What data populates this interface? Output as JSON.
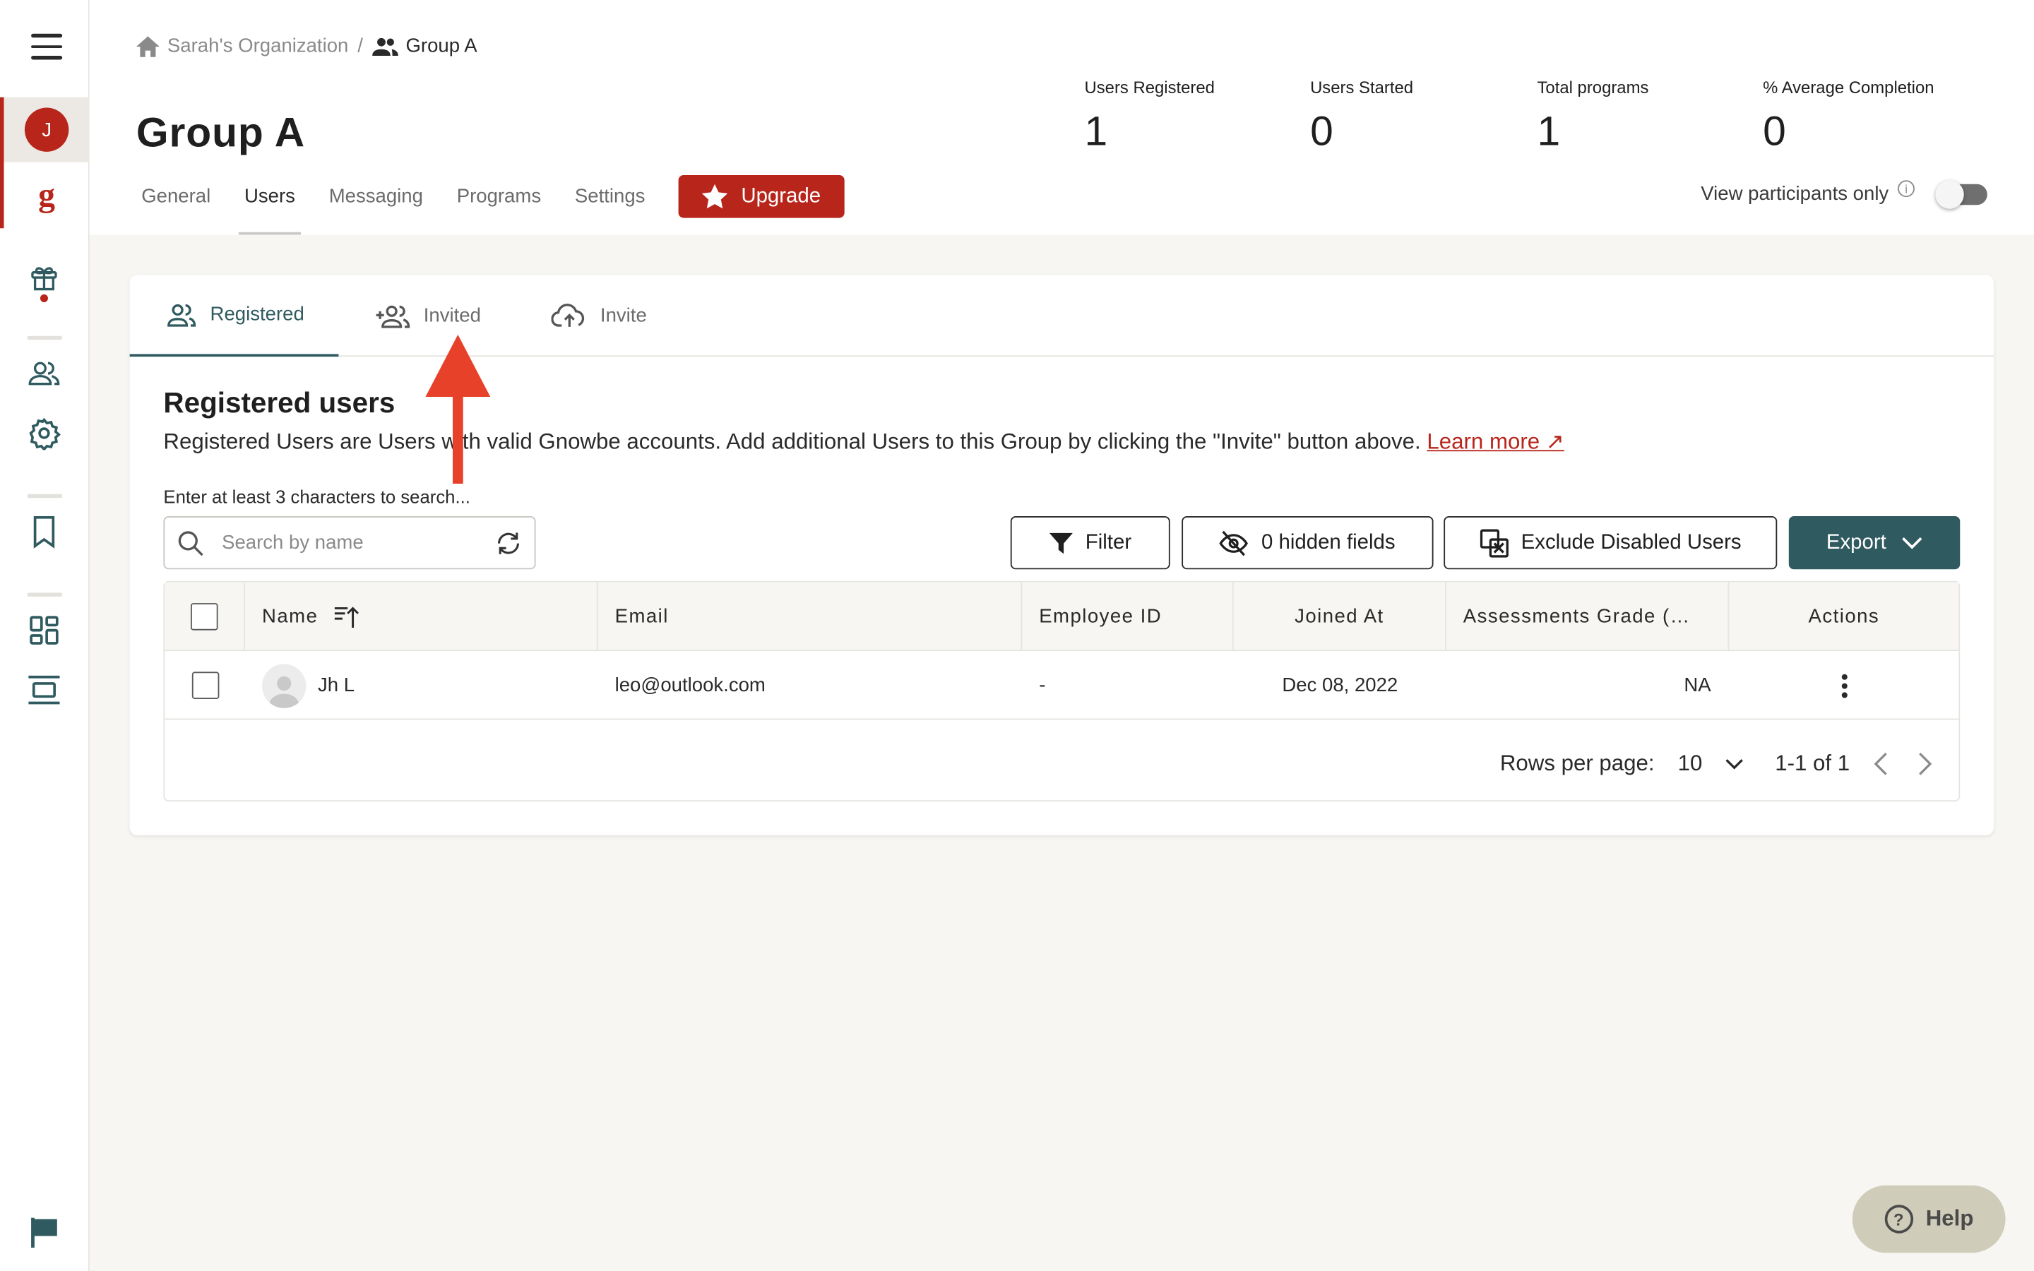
{
  "rail": {
    "avatar_letter": "J",
    "brand_letter": "g"
  },
  "breadcrumb": {
    "org": "Sarah's Organization",
    "separator": "/",
    "group": "Group A"
  },
  "page_title": "Group A",
  "stats": [
    {
      "label": "Users Registered",
      "value": "1"
    },
    {
      "label": "Users Started",
      "value": "0"
    },
    {
      "label": "Total programs",
      "value": "1"
    },
    {
      "label": "% Average Completion",
      "value": "0"
    }
  ],
  "tabs": [
    {
      "label": "General",
      "active": false
    },
    {
      "label": "Users",
      "active": true
    },
    {
      "label": "Messaging",
      "active": false
    },
    {
      "label": "Programs",
      "active": false
    },
    {
      "label": "Settings",
      "active": false
    }
  ],
  "upgrade_label": "Upgrade",
  "view_participants": {
    "label": "View participants only",
    "info": "i",
    "enabled": false
  },
  "subtabs": [
    {
      "label": "Registered",
      "active": true
    },
    {
      "label": "Invited",
      "active": false
    },
    {
      "label": "Invite",
      "active": false
    }
  ],
  "section": {
    "title": "Registered users",
    "description": "Registered Users are Users with valid Gnowbe accounts. Add additional Users to this Group by clicking the \"Invite\" button above.",
    "learn_more": "Learn more ↗",
    "hint": "Enter at least 3 characters to search..."
  },
  "search": {
    "placeholder": "Search by name",
    "value": ""
  },
  "toolbar": {
    "filter": "Filter",
    "hidden_fields": "0 hidden fields",
    "exclude_disabled": "Exclude Disabled Users",
    "export": "Export"
  },
  "table": {
    "columns": [
      "Name",
      "Email",
      "Employee ID",
      "Joined At",
      "Assessments Grade (…",
      "Actions"
    ],
    "rows": [
      {
        "name": "Jh L",
        "email": "leo@outlook.com",
        "employee_id": "-",
        "joined_at": "Dec 08, 2022",
        "grade": "NA"
      }
    ]
  },
  "pagination": {
    "rows_per_page_label": "Rows per page:",
    "rows_per_page": "10",
    "range": "1-1 of 1"
  },
  "help_label": "Help",
  "colors": {
    "brand_red": "#b8251b",
    "teal": "#2f5a5f",
    "annotation_arrow": "#e8412a",
    "help_bg": "#cfccb9"
  }
}
